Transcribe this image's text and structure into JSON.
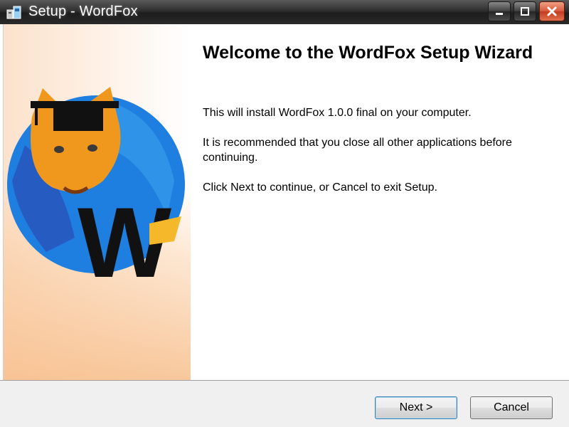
{
  "window": {
    "title": "Setup - WordFox",
    "controls": {
      "minimize_icon": "minimize-icon",
      "maximize_icon": "maximize-icon",
      "close_icon": "close-icon"
    }
  },
  "wizard": {
    "heading": "Welcome to the WordFox Setup Wizard",
    "paragraphs": [
      "This will install WordFox 1.0.0 final on your computer.",
      "It is recommended that you close all other applications before continuing.",
      "Click Next to continue, or Cancel to exit Setup."
    ],
    "logo_letter": "W"
  },
  "footer": {
    "next_label": "Next >",
    "cancel_label": "Cancel"
  },
  "colors": {
    "titlebar": "#2e2e2e",
    "close_button": "#d9583a",
    "logo_circle": "#1e7fe0",
    "fox": "#f0981e",
    "panel_gradient": "#f8c89c"
  }
}
